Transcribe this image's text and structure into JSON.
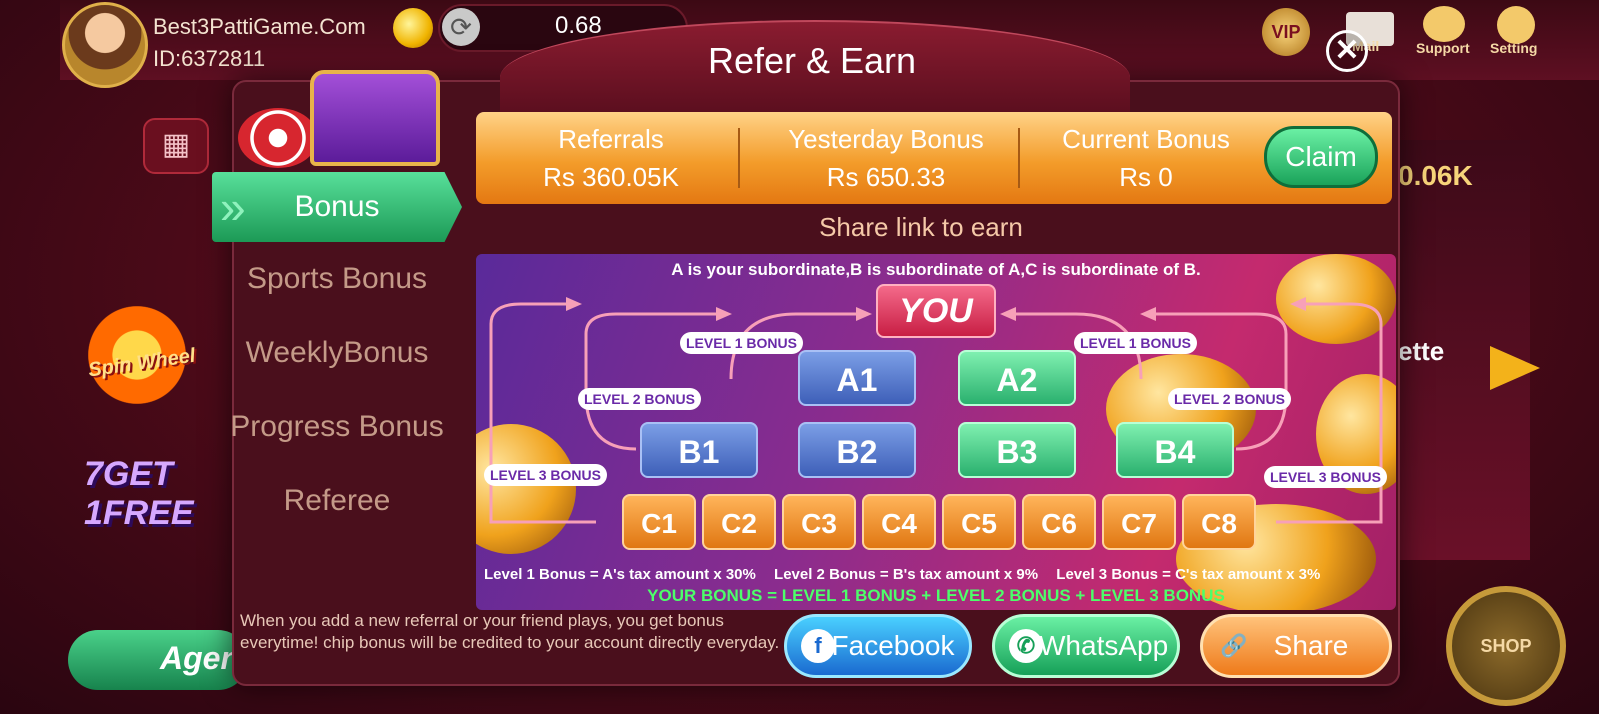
{
  "user": {
    "name": "Best3PattiGame.Com",
    "id": "ID:6372811"
  },
  "balance": "0.68",
  "top_icons": {
    "mail_label": "Mail",
    "support_label": "Support",
    "setting_label": "Setting",
    "vip_label": "VIP"
  },
  "background": {
    "right_value": "0.06K",
    "right_label": "ette",
    "spin_wheel_label": "Spin Wheel",
    "get1free_label": "7GET 1FREE",
    "agent_label": "Agen",
    "shop_label": "SHOP"
  },
  "modal": {
    "title": "Refer & Earn",
    "close_symbol": "✕",
    "tabs": [
      {
        "label": "Bonus",
        "active": true
      },
      {
        "label": "Sports Bonus",
        "active": false
      },
      {
        "label": "WeeklyBonus",
        "active": false
      },
      {
        "label": "Progress Bonus",
        "active": false
      },
      {
        "label": "Referee",
        "active": false
      }
    ],
    "stats": {
      "referrals_label": "Referrals",
      "referrals_value": "Rs  360.05K",
      "yesterday_label": "Yesterday Bonus",
      "yesterday_value": "Rs  650.33",
      "current_label": "Current Bonus",
      "current_value": "Rs  0"
    },
    "claim_label": "Claim",
    "share_prompt": "Share link to earn",
    "diagram": {
      "caption": "A is your subordinate,B is subordinate of A,C is subordinate of B.",
      "you_label": "YOU",
      "level1_tag": "LEVEL 1 BONUS",
      "level2_tag": "LEVEL 2 BONUS",
      "level3_tag": "LEVEL 3 BONUS",
      "a_nodes": [
        "A1",
        "A2"
      ],
      "b_nodes": [
        "B1",
        "B2",
        "B3",
        "B4"
      ],
      "c_nodes": [
        "C1",
        "C2",
        "C3",
        "C4",
        "C5",
        "C6",
        "C7",
        "C8"
      ],
      "formula1": "Level 1 Bonus = A's tax amount x 30%",
      "formula2": "Level 2 Bonus = B's tax amount x 9%",
      "formula3": "Level 3 Bonus = C's tax amount x 3%",
      "your_bonus": "YOUR BONUS = LEVEL 1 BONUS + LEVEL 2 BONUS + LEVEL 3 BONUS"
    },
    "footer_note": "When you add a new referral or your friend plays, you get bonus everytime! chip bonus will be credited to your account directly everyday.",
    "buttons": {
      "facebook": "Facebook",
      "whatsapp": "WhatsApp",
      "share": "Share"
    },
    "colors": {
      "accent_green": "#1c9a56",
      "accent_orange": "#f39c2a",
      "modal_bg": "#4a0f1c"
    }
  }
}
